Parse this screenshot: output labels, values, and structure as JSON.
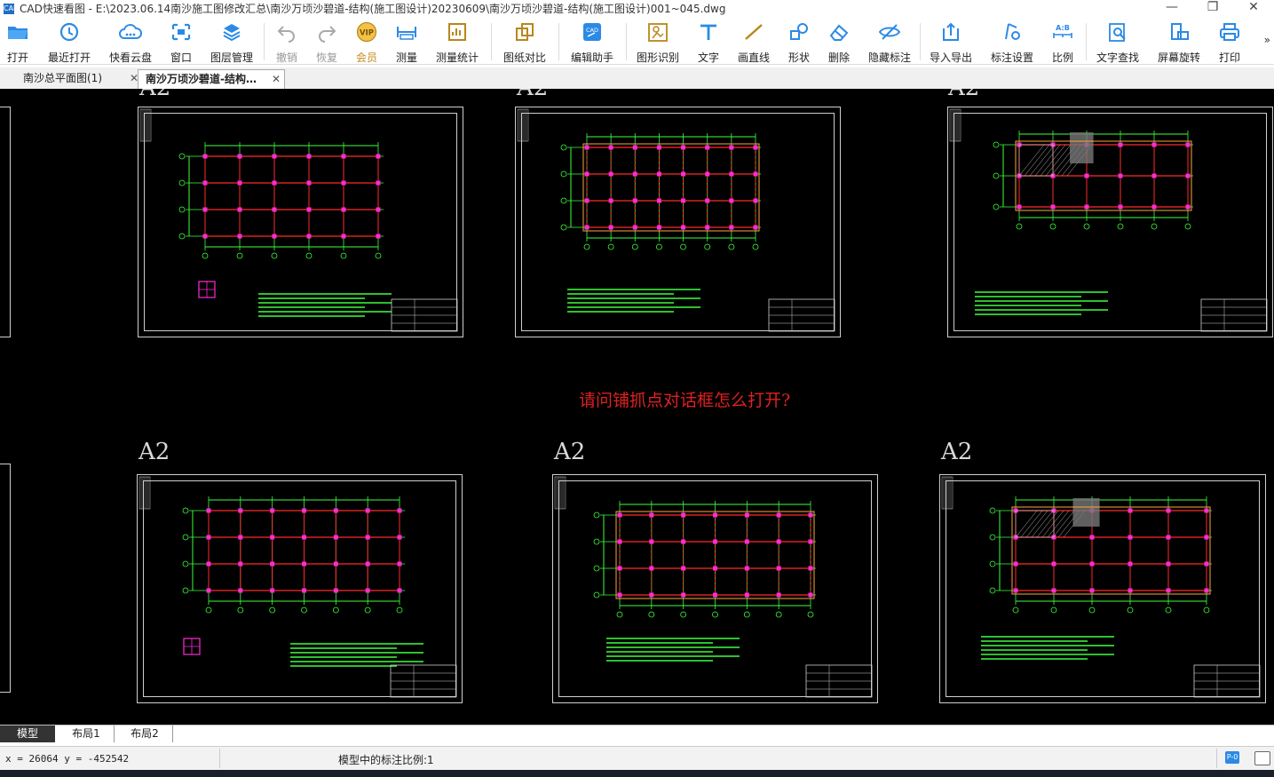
{
  "window": {
    "app_icon": "cad-app-icon",
    "title": "CAD快速看图 - E:\\2023.06.14南沙施工图修改汇总\\南沙万顷沙碧道-结构(施工图设计)20230609\\南沙万顷沙碧道-结构(施工图设计)001~045.dwg",
    "minimize": "—",
    "restore": "❐",
    "close": "✕"
  },
  "toolbar": {
    "items": [
      {
        "label": "打开",
        "icon": "folder-open-icon"
      },
      {
        "label": "最近打开",
        "icon": "recent-clock-icon"
      },
      {
        "label": "快看云盘",
        "icon": "cloud-icon"
      },
      {
        "label": "窗口",
        "icon": "window-frame-icon"
      },
      {
        "label": "图层管理",
        "icon": "layers-icon"
      },
      {
        "label": "撤销",
        "icon": "undo-icon"
      },
      {
        "label": "恢复",
        "icon": "redo-icon"
      },
      {
        "label": "会员",
        "icon": "vip-badge-icon"
      },
      {
        "label": "测量",
        "icon": "ruler-icon"
      },
      {
        "label": "测量统计",
        "icon": "measure-stats-icon"
      },
      {
        "label": "图纸对比",
        "icon": "compare-icon"
      },
      {
        "label": "编辑助手",
        "icon": "cad-edit-icon"
      },
      {
        "label": "图形识别",
        "icon": "shape-recognize-icon"
      },
      {
        "label": "文字",
        "icon": "text-t-icon"
      },
      {
        "label": "画直线",
        "icon": "line-icon"
      },
      {
        "label": "形状",
        "icon": "shape-icon"
      },
      {
        "label": "删除",
        "icon": "eraser-icon"
      },
      {
        "label": "隐藏标注",
        "icon": "eye-hide-icon"
      },
      {
        "label": "导入导出",
        "icon": "import-export-icon"
      },
      {
        "label": "标注设置",
        "icon": "annotation-settings-icon"
      },
      {
        "label": "比例",
        "icon": "scale-ab-icon"
      },
      {
        "label": "文字查找",
        "icon": "text-search-icon"
      },
      {
        "label": "屏幕旋转",
        "icon": "screen-rotate-icon"
      },
      {
        "label": "打印",
        "icon": "printer-icon"
      }
    ],
    "more": "»"
  },
  "tabs": [
    {
      "label": "南沙总平面图(1)",
      "close": "✕"
    },
    {
      "label": "南沙万顷沙碧道-结构…",
      "close": "✕"
    }
  ],
  "canvas": {
    "background": "#000000",
    "sheet_tags": [
      "A2",
      "A2",
      "A2",
      "A2",
      "A2",
      "A2"
    ],
    "question_text": "请问铺抓点对话框怎么打开?",
    "question_color": "#e02020"
  },
  "layout_tabs": [
    "模型",
    "布局1",
    "布局2"
  ],
  "status": {
    "coords": "x = 26064  y = -452542",
    "scale": "模型中的标注比例:1",
    "right_buttons": [
      "P-0",
      "layout-icon"
    ]
  },
  "colors": {
    "accent": "#1f6fc4",
    "grid_red": "#ff2a2a",
    "dim_green": "#3dff3d",
    "column_magenta": "#ff2bd6",
    "outline_white": "#cfcfcf",
    "note_yellow": "#ffe14d"
  }
}
